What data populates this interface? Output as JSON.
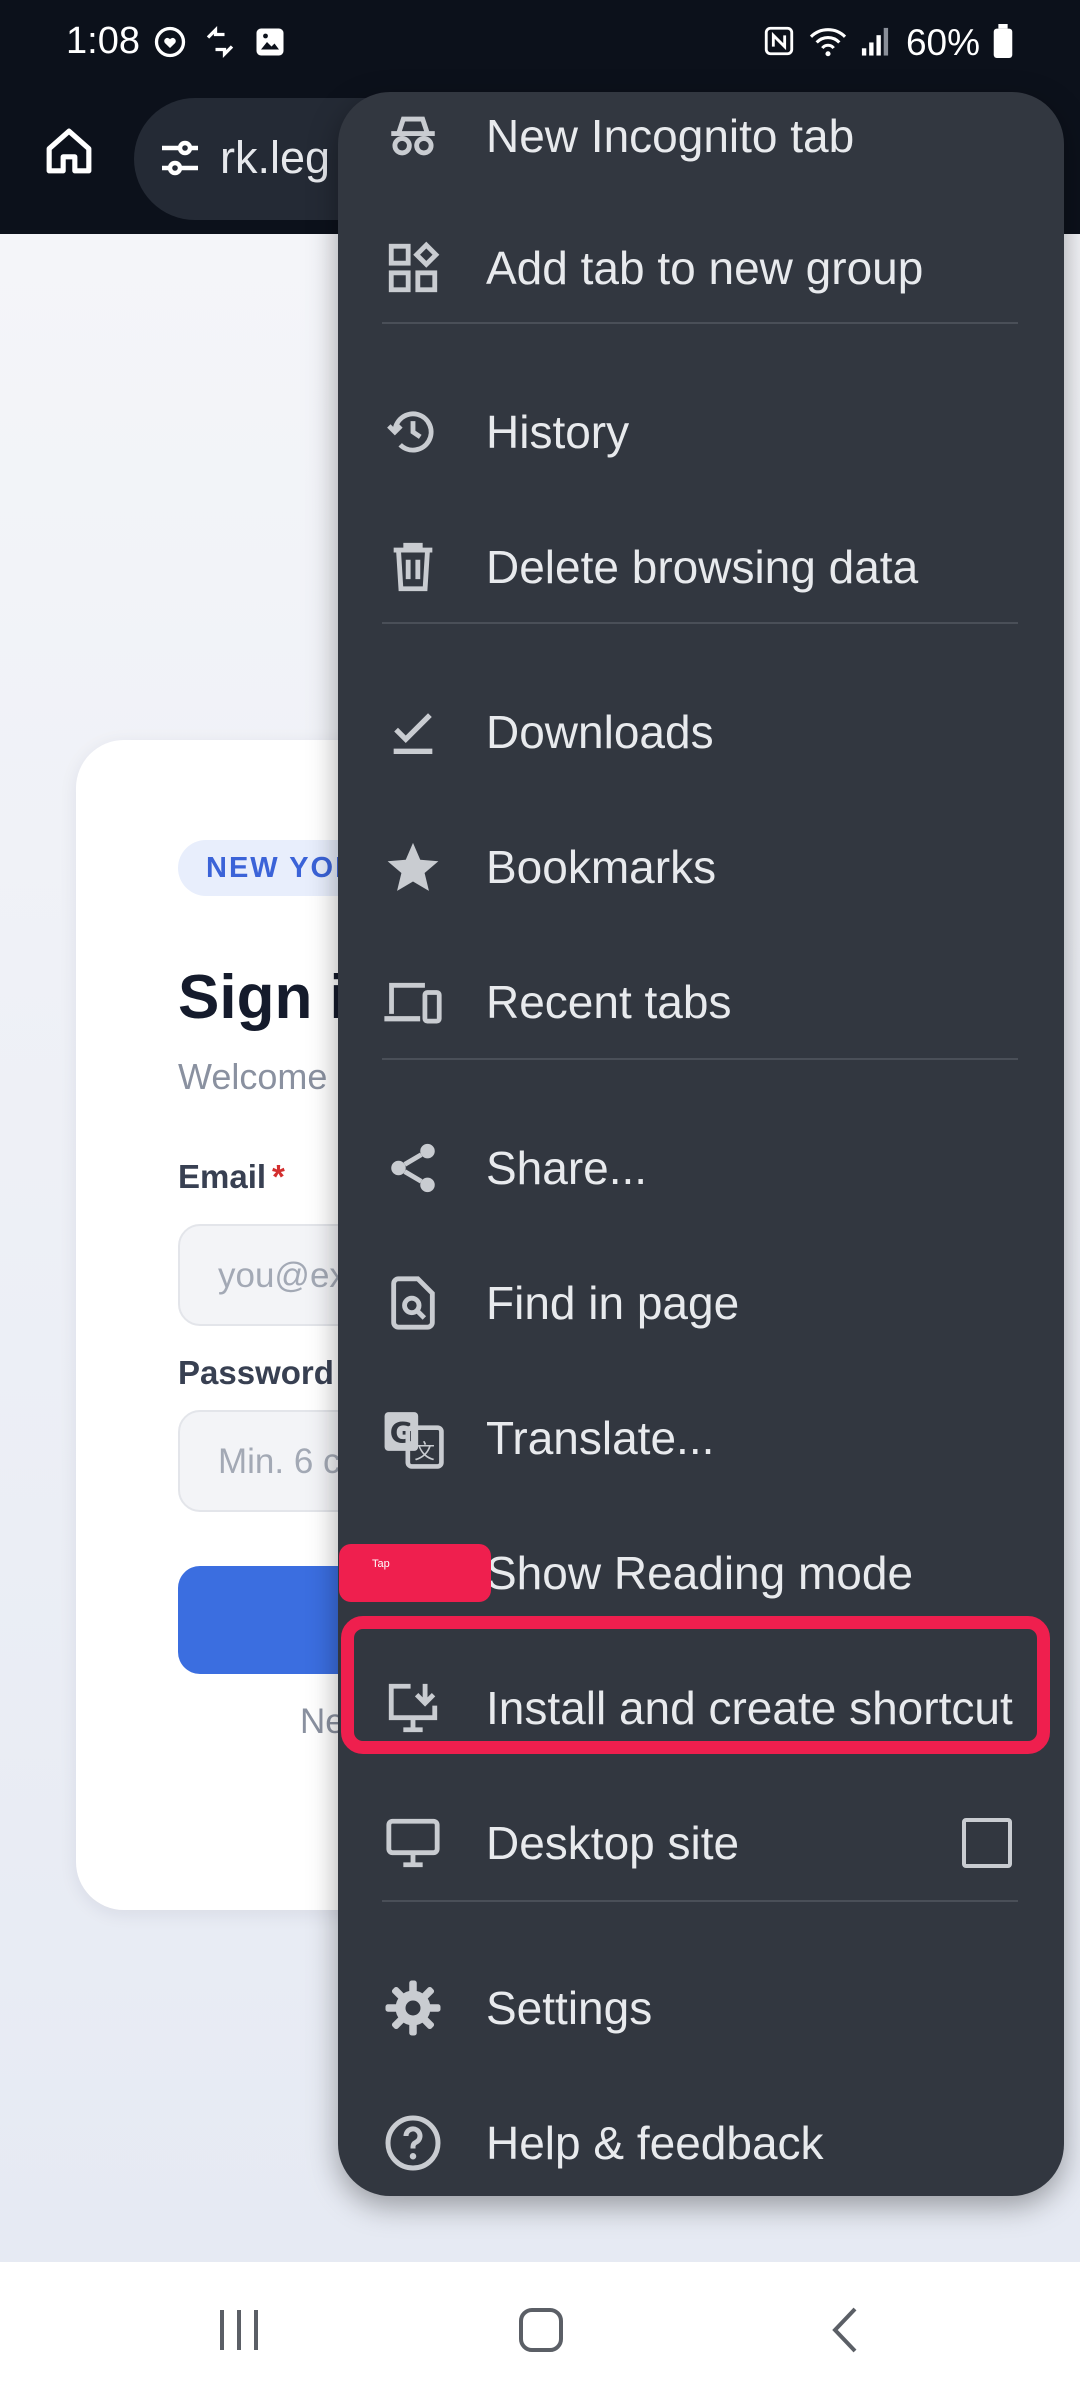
{
  "status_bar": {
    "time": "1:08",
    "battery": "60%"
  },
  "browser": {
    "url": "rk.leg"
  },
  "page": {
    "badge": "NEW YORK",
    "title": "Sign in",
    "subtitle": "Welcome",
    "email_label": "Email",
    "required_mark": "*",
    "email_placeholder": "you@ex",
    "password_label": "Password",
    "password_placeholder": "Min. 6 c",
    "footer_text": "Ne"
  },
  "menu": {
    "items": [
      {
        "label": "New Incognito tab",
        "icon": "incognito-icon"
      },
      {
        "label": "Add tab to new group",
        "icon": "tab-group-icon"
      },
      {
        "label": "History",
        "icon": "history-icon"
      },
      {
        "label": "Delete browsing data",
        "icon": "trash-icon"
      },
      {
        "label": "Downloads",
        "icon": "download-check-icon"
      },
      {
        "label": "Bookmarks",
        "icon": "star-icon"
      },
      {
        "label": "Recent tabs",
        "icon": "devices-icon"
      },
      {
        "label": "Share...",
        "icon": "share-icon"
      },
      {
        "label": "Find in page",
        "icon": "find-in-page-icon"
      },
      {
        "label": "Translate...",
        "icon": "translate-icon"
      },
      {
        "label": "Show Reading mode",
        "icon": "reading-mode-icon"
      },
      {
        "label": "Install and create shortcut",
        "icon": "install-desktop-icon"
      },
      {
        "label": "Desktop site",
        "icon": "desktop-icon",
        "checked": false
      },
      {
        "label": "Settings",
        "icon": "gear-icon"
      },
      {
        "label": "Help & feedback",
        "icon": "help-icon"
      }
    ]
  },
  "annotation": {
    "label": "Tap",
    "color": "#ef1f4e"
  },
  "colors": {
    "menu_bg": "#323740",
    "accent": "#3b6ee0"
  }
}
